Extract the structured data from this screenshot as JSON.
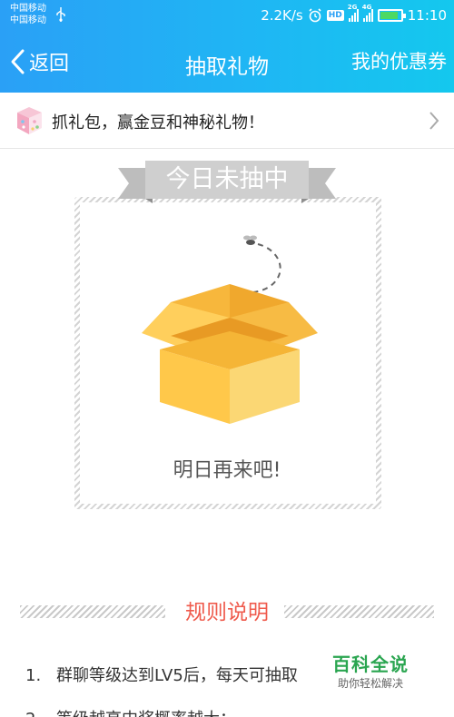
{
  "status_bar": {
    "carrier_1": "中国移动",
    "carrier_2": "中国移动",
    "speed": "2.2K/s",
    "hd_badge": "HD",
    "network_1": "2G",
    "network_2": "4G",
    "time": "11:10",
    "icons": [
      "usb-icon",
      "alarm-icon",
      "signal-icon",
      "battery-icon"
    ],
    "battery_level": 0.85
  },
  "navbar": {
    "back_label": "返回",
    "title": "抽取礼物",
    "right_action": "我的优惠券"
  },
  "promo": {
    "text": "抓礼包，赢金豆和神秘礼物！",
    "icon": "gift-box-icon"
  },
  "draw_card": {
    "ribbon_label": "今日未抽中",
    "message": "明日再来吧!",
    "illustration": "open-box-icon"
  },
  "rules": {
    "title": "规则说明",
    "items": [
      {
        "num": "1.",
        "text": "群聊等级达到LV5后，每天可抽取"
      },
      {
        "num": "2.",
        "text": "等级越高中奖概率越大；"
      }
    ]
  },
  "watermark": {
    "main": "百科全说",
    "sub": "助你轻松解决"
  },
  "colors": {
    "header_start": "#2aa0f6",
    "header_end": "#14c8ee",
    "rules_title": "#ef5a4c",
    "box": "#ffc84a",
    "ribbon": "#cfcfcf"
  }
}
